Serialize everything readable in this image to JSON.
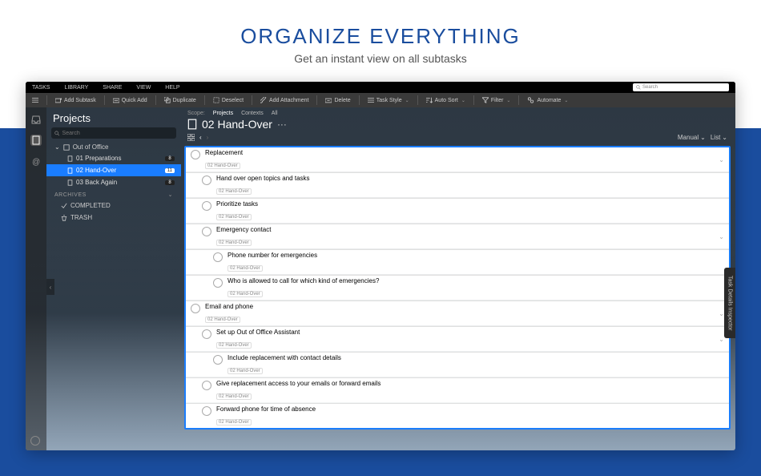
{
  "hero": {
    "title": "ORGANIZE EVERYTHING",
    "subtitle": "Get an instant view on all subtasks"
  },
  "menubar": {
    "items": [
      "TASKS",
      "LIBRARY",
      "SHARE",
      "VIEW",
      "HELP"
    ],
    "search_placeholder": "Search"
  },
  "toolbar": {
    "add_subtask": "Add Subtask",
    "quick_add": "Quick Add",
    "duplicate": "Duplicate",
    "deselect": "Deselect",
    "add_attachment": "Add Attachment",
    "delete": "Delete",
    "task_style": "Task Style",
    "auto_sort": "Auto Sort",
    "filter": "Filter",
    "automate": "Automate"
  },
  "sidebar": {
    "heading": "Projects",
    "search_placeholder": "Search",
    "group": "Out of Office",
    "items": [
      {
        "label": "01 Preparations",
        "count": "8"
      },
      {
        "label": "02 Hand-Over",
        "count": "11"
      },
      {
        "label": "03 Back Again",
        "count": "8"
      }
    ],
    "archives_label": "ARCHIVES",
    "completed": "COMPLETED",
    "trash": "TRASH"
  },
  "scope": {
    "label": "Scope:",
    "projects": "Projects",
    "contexts": "Contexts",
    "all": "All"
  },
  "content": {
    "title": "02 Hand-Over",
    "ellipsis": "···",
    "sort": "Manual",
    "view": "List"
  },
  "tasks": [
    {
      "indent": 0,
      "title": "Replacement",
      "tag": "02 Hand-Over",
      "chev": true
    },
    {
      "indent": 1,
      "title": "Hand over open topics and tasks",
      "tag": "02 Hand-Over"
    },
    {
      "indent": 1,
      "title": "Prioritize tasks",
      "tag": "02 Hand-Over"
    },
    {
      "indent": 1,
      "title": "Emergency contact",
      "tag": "02 Hand-Over",
      "chev": true
    },
    {
      "indent": 2,
      "title": "Phone number for emergencies",
      "tag": "02 Hand-Over"
    },
    {
      "indent": 2,
      "title": "Who is allowed to call for which kind of emergencies?",
      "tag": "02 Hand-Over"
    },
    {
      "indent": 0,
      "title": "Email and phone",
      "tag": "02 Hand-Over",
      "chev": true
    },
    {
      "indent": 1,
      "title": "Set up Out of Office Assistant",
      "tag": "02 Hand-Over",
      "chev": true
    },
    {
      "indent": 2,
      "title": "Include replacement with contact details",
      "tag": "02 Hand-Over"
    },
    {
      "indent": 1,
      "title": "Give replacement access to your emails or forward emails",
      "tag": "02 Hand-Over"
    },
    {
      "indent": 1,
      "title": "Forward phone for time of absence",
      "tag": "02 Hand-Over"
    }
  ],
  "inspector": "Task Details Inspector"
}
